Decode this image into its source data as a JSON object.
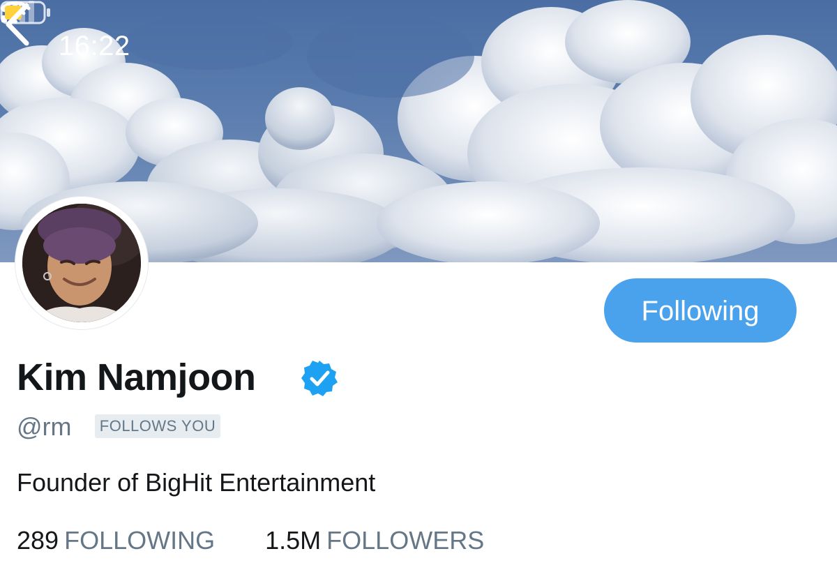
{
  "status_bar": {
    "time": "16:22",
    "location_icon": "location-arrow-icon",
    "signal_icon": "cellular-signal-icon",
    "wifi_icon": "wifi-icon",
    "battery_icon": "battery-icon",
    "battery_color": "#ffd23c"
  },
  "header": {
    "back_icon": "chevron-left-icon",
    "banner_description_colors": {
      "sky": "#4a6ea4",
      "cloud": "#e9edf3"
    }
  },
  "profile": {
    "follow_button_label": "Following",
    "display_name": "Kim Namjoon",
    "verified_icon": "verified-badge-icon",
    "handle": "@rm",
    "follows_you_label": "FOLLOWS YOU",
    "bio": "Founder of BigHit Entertainment",
    "stats": [
      {
        "count": "289",
        "label": "FOLLOWING"
      },
      {
        "count": "1.5M",
        "label": "FOLLOWERS"
      }
    ]
  },
  "colors": {
    "accent": "#4aa1ec",
    "verified": "#1da1f2",
    "secondary_text": "#657786",
    "primary_text": "#14171a"
  }
}
